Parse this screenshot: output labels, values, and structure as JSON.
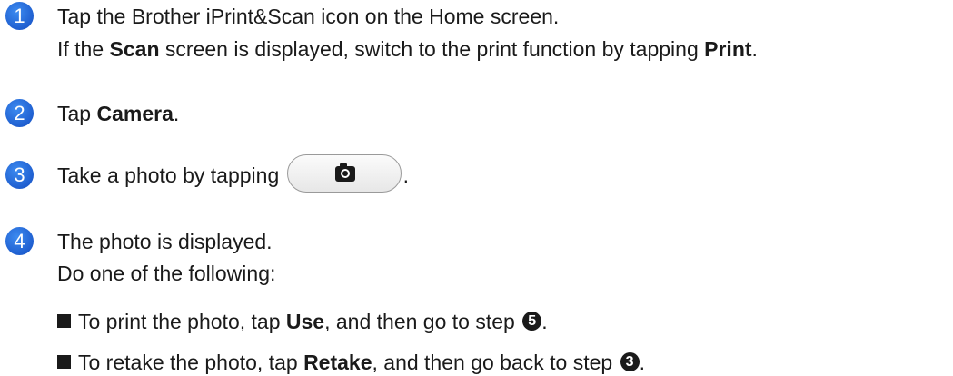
{
  "steps": [
    {
      "number": "1",
      "line1": "Tap the Brother iPrint&Scan icon on the Home screen.",
      "line2_a": "If the ",
      "line2_b": "Scan",
      "line2_c": " screen is displayed, switch to the print function by tapping ",
      "line2_d": "Print",
      "line2_e": "."
    },
    {
      "number": "2",
      "text_a": "Tap ",
      "text_b": "Camera",
      "text_c": "."
    },
    {
      "number": "3",
      "text_a": "Take a photo by tapping ",
      "button_icon": "camera-icon",
      "text_c": "."
    },
    {
      "number": "4",
      "line1": "The photo is displayed.",
      "line2": "Do one of the following:",
      "options": [
        {
          "a": "To print the photo, tap ",
          "b": "Use",
          "c": ", and then go to step ",
          "ref": "5",
          "d": "."
        },
        {
          "a": "To retake the photo, tap ",
          "b": "Retake",
          "c": ", and then go back to step ",
          "ref": "3",
          "d": "."
        }
      ]
    }
  ],
  "colors": {
    "step_badge": "#1f5fd0",
    "text": "#1a1a1a"
  }
}
